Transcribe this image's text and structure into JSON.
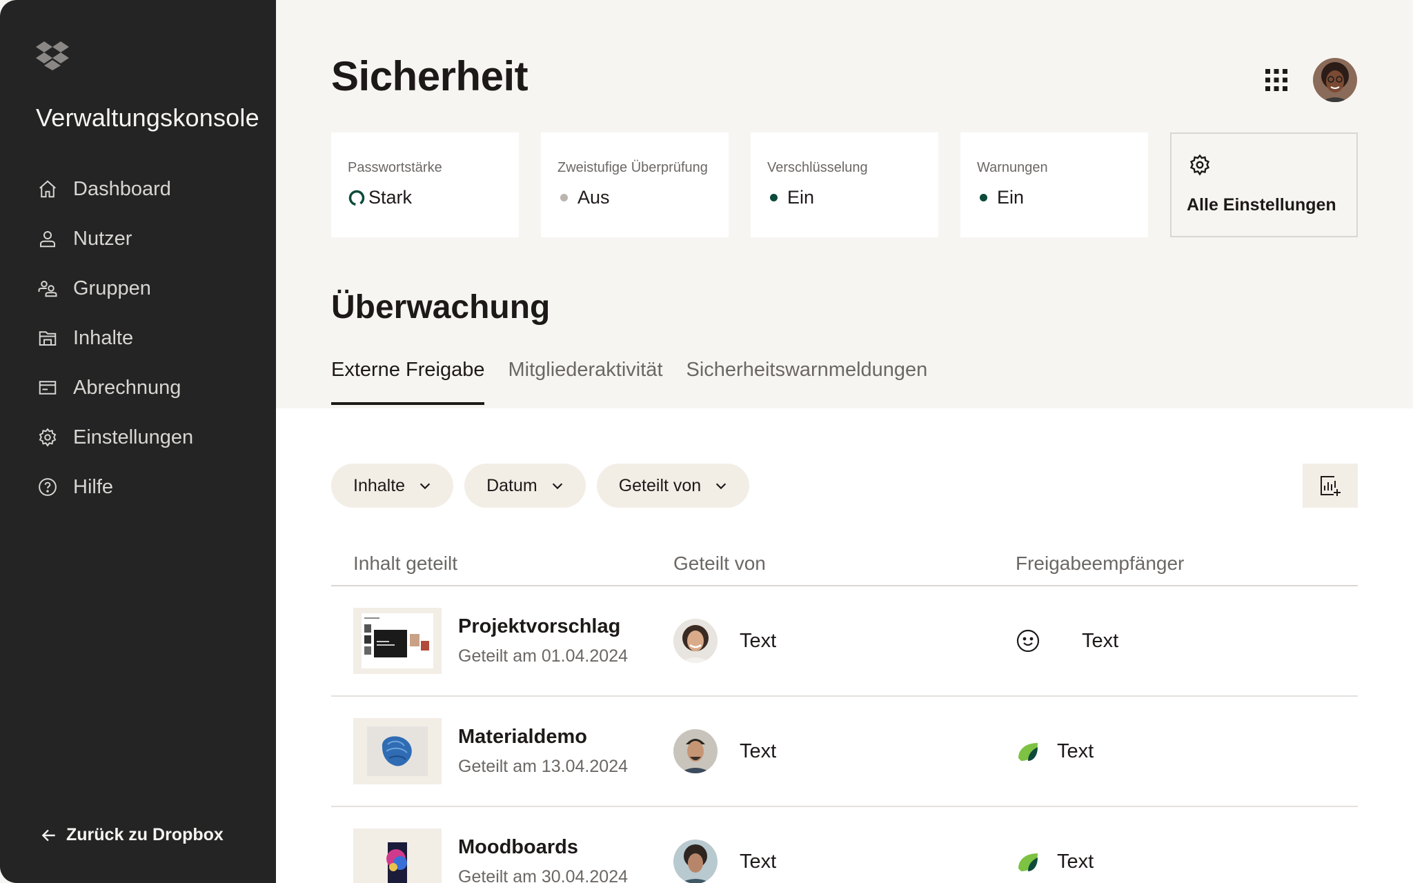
{
  "sidebar": {
    "brand": "Verwaltungskonsole",
    "items": [
      {
        "label": "Dashboard",
        "icon": "home-icon"
      },
      {
        "label": "Nutzer",
        "icon": "user-icon"
      },
      {
        "label": "Gruppen",
        "icon": "group-icon"
      },
      {
        "label": "Inhalte",
        "icon": "folder-icon"
      },
      {
        "label": "Abrechnung",
        "icon": "billing-icon"
      },
      {
        "label": "Einstellungen",
        "icon": "gear-icon"
      },
      {
        "label": "Hilfe",
        "icon": "help-icon"
      }
    ],
    "back_label": "Zurück zu Dropbox"
  },
  "header": {
    "title": "Sicherheit"
  },
  "status_cards": [
    {
      "label": "Passwortstärke",
      "value": "Stark"
    },
    {
      "label": "Zweistufige Überprüfung",
      "value": "Aus",
      "status_color": "#bbb5ae"
    },
    {
      "label": "Verschlüsselung",
      "value": "Ein",
      "status_color": "#0e4a3b"
    },
    {
      "label": "Warnungen",
      "value": "Ein",
      "status_color": "#0e4a3b"
    }
  ],
  "settings_card": {
    "label": "Alle Einstellungen"
  },
  "monitoring": {
    "title": "Überwachung",
    "tabs": [
      {
        "label": "Externe Freigabe",
        "active": true
      },
      {
        "label": "Mitgliederaktivität",
        "active": false
      },
      {
        "label": "Sicherheitswarnmeldungen",
        "active": false
      }
    ]
  },
  "filters": [
    {
      "label": "Inhalte"
    },
    {
      "label": "Datum"
    },
    {
      "label": "Geteilt von"
    }
  ],
  "table": {
    "columns": [
      "Inhalt geteilt",
      "Geteilt von",
      "Freigabeempfänger"
    ],
    "rows": [
      {
        "name": "Projektvorschlag",
        "date": "Geteilt am 01.04.2024",
        "shared_by": "Text",
        "recipient": "Text",
        "recipient_icon": "smiley-icon"
      },
      {
        "name": "Materialdemo",
        "date": "Geteilt am 13.04.2024",
        "shared_by": "Text",
        "recipient": "Text",
        "recipient_icon": "leaf-icon"
      },
      {
        "name": "Moodboards",
        "date": "Geteilt am 30.04.2024",
        "shared_by": "Text",
        "recipient": "Text",
        "recipient_icon": "leaf-icon"
      }
    ]
  },
  "colors": {
    "sidebar_bg": "#242424",
    "page_bg": "#f7f5f2",
    "pill_bg": "#f2eee6",
    "accent_green": "#0e4a3b",
    "leaf_green": "#7dc242"
  }
}
